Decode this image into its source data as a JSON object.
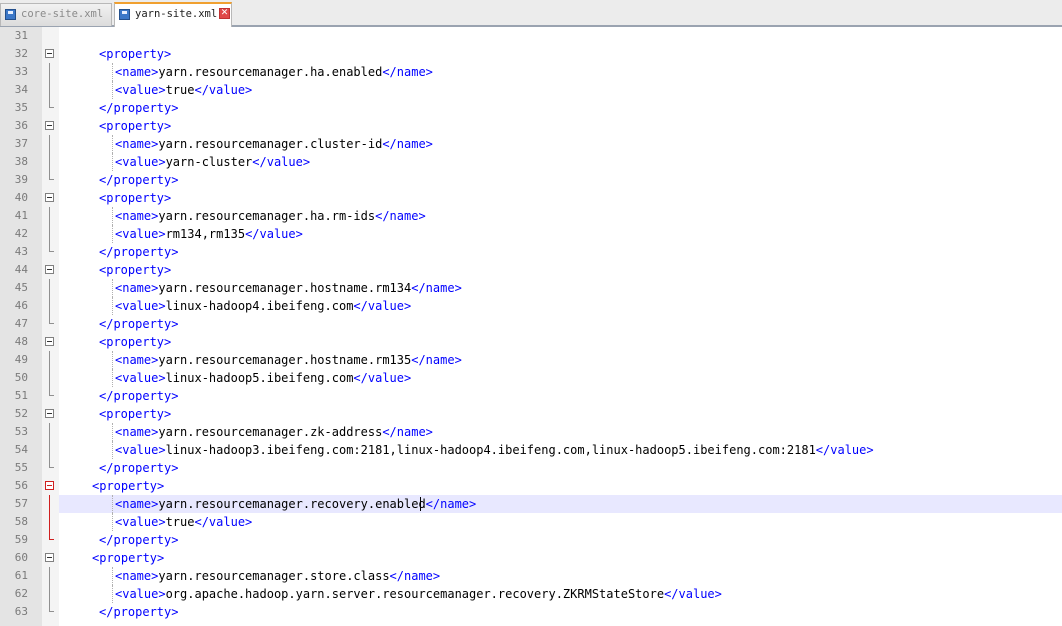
{
  "tabs": [
    {
      "label": "core-site.xml",
      "active": false
    },
    {
      "label": "yarn-site.xml",
      "active": true
    }
  ],
  "editor": {
    "current_line": 57,
    "lines": [
      {
        "no": "31",
        "indent": 0,
        "open": "",
        "text": "",
        "close": ""
      },
      {
        "no": "32",
        "indent": 1,
        "open": "<property>",
        "text": "",
        "close": ""
      },
      {
        "no": "33",
        "indent": 2,
        "open": "<name>",
        "text": "yarn.resourcemanager.ha.enabled",
        "close": "</name>"
      },
      {
        "no": "34",
        "indent": 2,
        "open": "<value>",
        "text": "true",
        "close": "</value>"
      },
      {
        "no": "35",
        "indent": 1,
        "open": "",
        "text": "",
        "close": "</property>"
      },
      {
        "no": "36",
        "indent": 1,
        "open": "<property>",
        "text": "",
        "close": ""
      },
      {
        "no": "37",
        "indent": 2,
        "open": "<name>",
        "text": "yarn.resourcemanager.cluster-id",
        "close": "</name>"
      },
      {
        "no": "38",
        "indent": 2,
        "open": "<value>",
        "text": "yarn-cluster",
        "close": "</value>"
      },
      {
        "no": "39",
        "indent": 1,
        "open": "",
        "text": "",
        "close": "</property>"
      },
      {
        "no": "40",
        "indent": 1,
        "open": "<property>",
        "text": "",
        "close": ""
      },
      {
        "no": "41",
        "indent": 2,
        "open": "<name>",
        "text": "yarn.resourcemanager.ha.rm-ids",
        "close": "</name>"
      },
      {
        "no": "42",
        "indent": 2,
        "open": "<value>",
        "text": "rm134,rm135",
        "close": "</value>"
      },
      {
        "no": "43",
        "indent": 1,
        "open": "",
        "text": "",
        "close": "</property>"
      },
      {
        "no": "44",
        "indent": 1,
        "open": "<property>",
        "text": "",
        "close": ""
      },
      {
        "no": "45",
        "indent": 2,
        "open": "<name>",
        "text": "yarn.resourcemanager.hostname.rm134",
        "close": "</name>"
      },
      {
        "no": "46",
        "indent": 2,
        "open": "<value>",
        "text": "linux-hadoop4.ibeifeng.com",
        "close": "</value>"
      },
      {
        "no": "47",
        "indent": 1,
        "open": "",
        "text": "",
        "close": "</property>"
      },
      {
        "no": "48",
        "indent": 1,
        "open": "<property>",
        "text": "",
        "close": ""
      },
      {
        "no": "49",
        "indent": 2,
        "open": "<name>",
        "text": "yarn.resourcemanager.hostname.rm135",
        "close": "</name>"
      },
      {
        "no": "50",
        "indent": 2,
        "open": "<value>",
        "text": "linux-hadoop5.ibeifeng.com",
        "close": "</value>"
      },
      {
        "no": "51",
        "indent": 1,
        "open": "",
        "text": "",
        "close": "</property>"
      },
      {
        "no": "52",
        "indent": 1,
        "open": "<property>",
        "text": "",
        "close": ""
      },
      {
        "no": "53",
        "indent": 2,
        "open": "<name>",
        "text": "yarn.resourcemanager.zk-address",
        "close": "</name>"
      },
      {
        "no": "54",
        "indent": 2,
        "open": "<value>",
        "text": "linux-hadoop3.ibeifeng.com:2181,linux-hadoop4.ibeifeng.com,linux-hadoop5.ibeifeng.com:2181",
        "close": "</value>"
      },
      {
        "no": "55",
        "indent": 1,
        "open": "",
        "text": "",
        "close": "</property>"
      },
      {
        "no": "56",
        "indent": 0,
        "open": "<property>",
        "text": "",
        "close": ""
      },
      {
        "no": "57",
        "indent": 2,
        "open": "<name>",
        "text": "yarn.resourcemanager.recovery.enabled",
        "close": "</name>"
      },
      {
        "no": "58",
        "indent": 2,
        "open": "<value>",
        "text": "true",
        "close": "</value>"
      },
      {
        "no": "59",
        "indent": 1,
        "open": "",
        "text": "",
        "close": "</property>"
      },
      {
        "no": "60",
        "indent": 0,
        "open": "<property>",
        "text": "",
        "close": ""
      },
      {
        "no": "61",
        "indent": 2,
        "open": "<name>",
        "text": "yarn.resourcemanager.store.class",
        "close": "</name>"
      },
      {
        "no": "62",
        "indent": 2,
        "open": "<value>",
        "text": "org.apache.hadoop.yarn.server.resourcemanager.recovery.ZKRMStateStore",
        "close": "</value>"
      },
      {
        "no": "63",
        "indent": 1,
        "open": "",
        "text": "",
        "close": "</property>"
      }
    ]
  }
}
